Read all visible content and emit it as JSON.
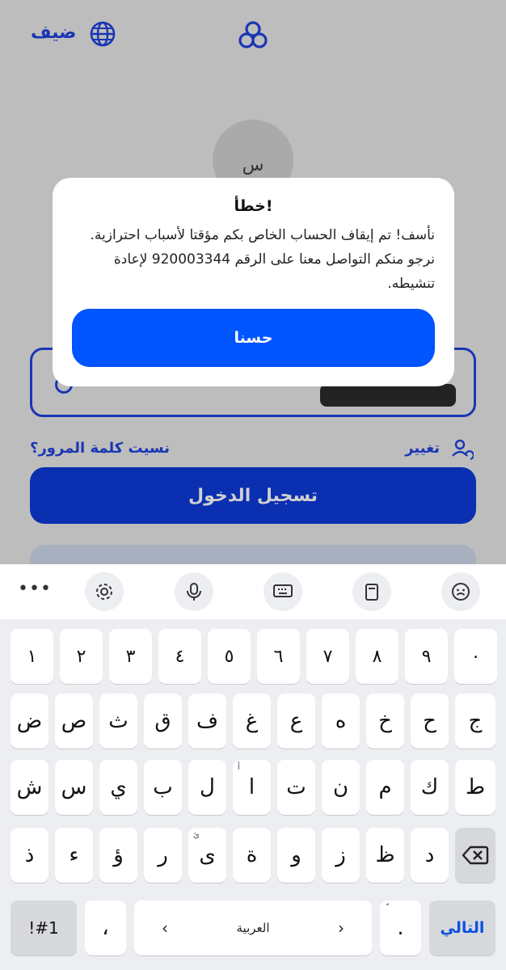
{
  "header": {
    "guest_label": "ضيف"
  },
  "avatar": {
    "letter": "س"
  },
  "links": {
    "forgot_password": "نسيت كلمة المرور؟",
    "change": "تغيير"
  },
  "login": {
    "label": "تسجيل الدخول"
  },
  "dialog": {
    "title": "خطأ!",
    "message": "نأسف! تم إيقاف الحساب الخاص بكم مؤقتا لأسباب احترازية. نرجو منكم التواصل معنا على الرقم 920003344 لإعادة تنشيطه.",
    "ok_label": "حسنا"
  },
  "keyboard": {
    "toolbar_icons": [
      "emoji-icon",
      "clipboard-icon",
      "keyboard-icon",
      "mic-icon",
      "settings-icon",
      "more-icon"
    ],
    "row_numbers": [
      "١",
      "٢",
      "٣",
      "٤",
      "٥",
      "٦",
      "٧",
      "٨",
      "٩",
      "٠"
    ],
    "row1": [
      "ض",
      "ص",
      "ث",
      "ق",
      "ف",
      "غ",
      "ع",
      "ه",
      "خ",
      "ح",
      "ج"
    ],
    "row2": [
      "ش",
      "س",
      "ي",
      "ب",
      "ل",
      "ا",
      "ت",
      "ن",
      "م",
      "ك",
      "ط"
    ],
    "row3": [
      "ذ",
      "ء",
      "ؤ",
      "ر",
      "ى",
      "ة",
      "و",
      "ز",
      "ظ",
      "د"
    ],
    "symbols_label": "!#1",
    "comma": "،",
    "space_label": "العربية",
    "period": ".",
    "next_label": "التالي",
    "hint_alef": "أ",
    "hint_ya": "ئ",
    "hint_period": "ّ"
  },
  "colors": {
    "brand": "#1a36b4",
    "dialog_button": "#0055fe",
    "next_text": "#0a50e0"
  }
}
